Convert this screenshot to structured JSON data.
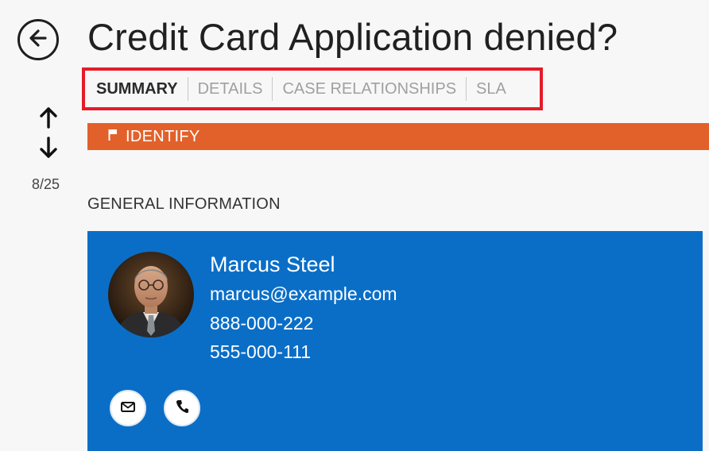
{
  "header": {
    "title": "Credit Card Application denied?"
  },
  "tabs": [
    {
      "label": "SUMMARY",
      "active": true
    },
    {
      "label": "DETAILS",
      "active": false
    },
    {
      "label": "CASE RELATIONSHIPS",
      "active": false
    },
    {
      "label": "SLA",
      "active": false
    }
  ],
  "nav": {
    "position": "8/25"
  },
  "stage": {
    "label": "IDENTIFY",
    "color": "#e2612a"
  },
  "section": {
    "heading": "GENERAL INFORMATION"
  },
  "contact": {
    "name": "Marcus Steel",
    "email": "marcus@example.com",
    "phone_primary": "888-000-222",
    "phone_secondary": "555-000-111",
    "card_color": "#0a6ec7"
  },
  "icons": {
    "back": "back-arrow-icon",
    "up": "arrow-up-icon",
    "down": "arrow-down-icon",
    "flag": "flag-icon",
    "email": "envelope-icon",
    "call": "phone-icon"
  },
  "colors": {
    "highlight_border": "#e41b2a",
    "active_tab": "#2a2a2a",
    "inactive_tab": "#a0a0a0"
  }
}
